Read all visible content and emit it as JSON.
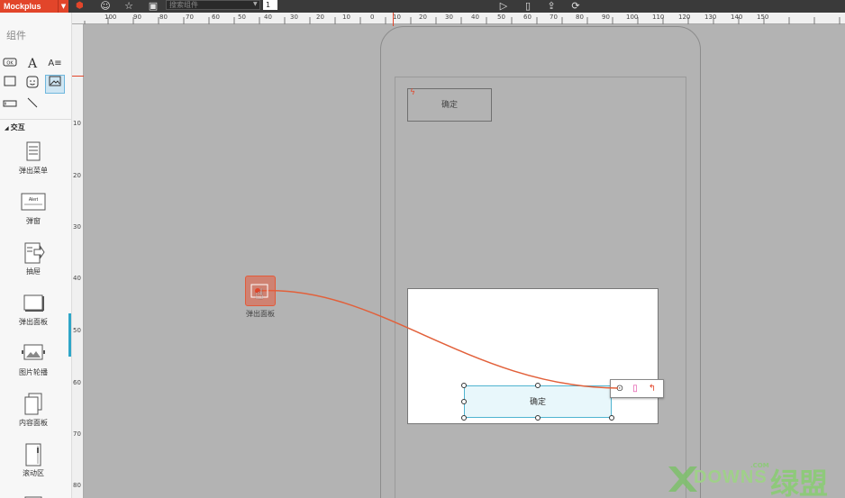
{
  "app": {
    "brand": "Mockplus",
    "search_placeholder": "搜索组件",
    "page_number": "1"
  },
  "toolbar": {
    "icons": [
      "cube-icon",
      "smiley-icon",
      "star-icon",
      "image-icon",
      "play-icon",
      "phone-icon",
      "upload-icon",
      "sync-icon"
    ]
  },
  "left_panel": {
    "title": "组件",
    "basic_icons": [
      "ok-button-icon",
      "text-icon",
      "paragraph-icon",
      "rectangle-icon",
      "emoji-icon",
      "picture-icon",
      "input-icon",
      "line-icon"
    ],
    "section": "交互",
    "components": [
      "弹出菜单",
      "弹窗",
      "抽屉",
      "弹出面板",
      "图片轮播",
      "内容面板",
      "滚动区"
    ]
  },
  "ruler_top": [
    "100",
    "90",
    "80",
    "70",
    "60",
    "50",
    "40",
    "30",
    "20",
    "10",
    "0",
    "10",
    "20",
    "30",
    "40",
    "50",
    "60",
    "70",
    "80",
    "90",
    "100",
    "110",
    "120",
    "130",
    "140",
    "150"
  ],
  "ruler_left": [
    "10",
    "20",
    "30",
    "40",
    "50",
    "60",
    "70",
    "80"
  ],
  "canvas": {
    "top_button": "确定",
    "selected_button": "确定",
    "dragged_component": "弹出面板"
  },
  "watermark": {
    "text": "DOWNS",
    "com": ".COM",
    "cn": "绿盟"
  },
  "colors": {
    "brand": "#e2452a",
    "accent": "#2fa6c8",
    "link": "#e25a3a"
  }
}
